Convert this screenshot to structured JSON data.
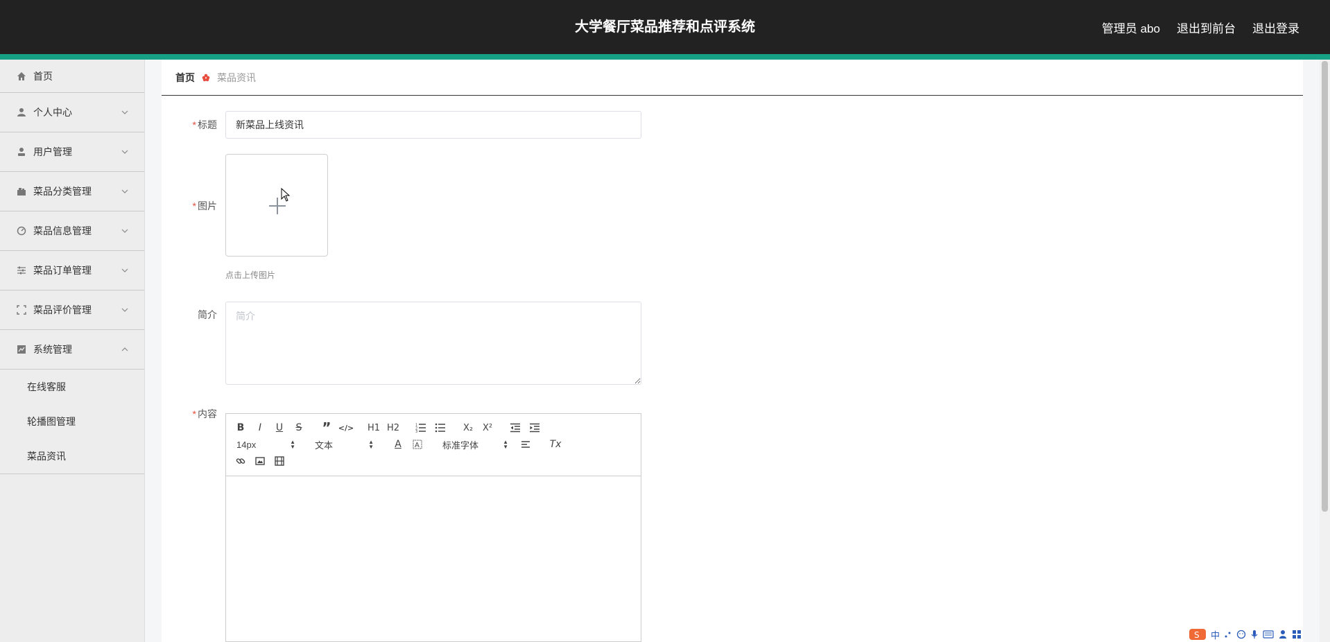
{
  "header": {
    "title": "大学餐厅菜品推荐和点评系统",
    "user_label": "管理员 abo",
    "front_link": "退出到前台",
    "logout_link": "退出登录"
  },
  "sidebar": {
    "items": [
      {
        "label": "首页",
        "icon": "home-icon"
      },
      {
        "label": "个人中心",
        "icon": "user-icon"
      },
      {
        "label": "用户管理",
        "icon": "users-icon"
      },
      {
        "label": "菜品分类管理",
        "icon": "category-icon"
      },
      {
        "label": "菜品信息管理",
        "icon": "dashboard-icon"
      },
      {
        "label": "菜品订单管理",
        "icon": "sliders-icon"
      },
      {
        "label": "菜品评价管理",
        "icon": "fullscreen-icon"
      },
      {
        "label": "系统管理",
        "icon": "chart-icon"
      }
    ],
    "sub_items": [
      "在线客服",
      "轮播图管理",
      "菜品资讯"
    ]
  },
  "breadcrumb": {
    "home": "首页",
    "current": "菜品资讯"
  },
  "form": {
    "title_label": "标题",
    "title_value": "新菜品上线资讯",
    "image_label": "图片",
    "upload_hint": "点击上传图片",
    "intro_label": "简介",
    "intro_placeholder": "简介",
    "content_label": "内容",
    "required_mark": "*"
  },
  "editor": {
    "size_value": "14px",
    "header_value": "文本",
    "font_value": "标准字体",
    "buttons": [
      "B",
      "I",
      "U",
      "S",
      "”",
      "</>",
      "H1",
      "H2",
      "ordered-list",
      "bullet-list",
      "X₂",
      "X²",
      "outdent",
      "indent",
      "A",
      "background",
      "align",
      "Tx",
      "link",
      "image",
      "video"
    ]
  },
  "ime_tray": {
    "lang": "中"
  },
  "colors": {
    "header_bg": "#222222",
    "accent": "#16a085",
    "required": "#e74c3c",
    "sidebar_bg": "#ededed"
  }
}
